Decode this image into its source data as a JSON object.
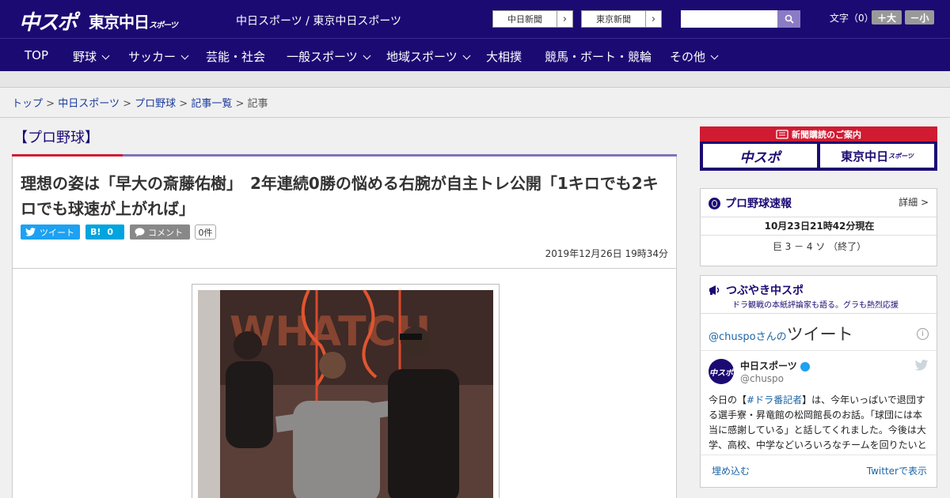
{
  "header": {
    "logo_chuspo": "中スポ",
    "logo_tokyo": "東京中日",
    "logo_tokyo_small": "スポーツ",
    "site_names": "中日スポーツ / 東京中日スポーツ",
    "ext_links": [
      {
        "label": "中日新聞"
      },
      {
        "label": "東京新聞"
      }
    ],
    "search_placeholder": "",
    "font_size_label": "文字（0）",
    "font_plus": "＋大",
    "font_minus": "－小"
  },
  "nav": {
    "items": [
      {
        "label": "TOP"
      },
      {
        "label": "野球"
      },
      {
        "label": "サッカー"
      },
      {
        "label": "芸能・社会"
      },
      {
        "label": "一般スポーツ"
      },
      {
        "label": "地域スポーツ"
      },
      {
        "label": "大相撲"
      },
      {
        "label": "競馬・ボート・競輪"
      },
      {
        "label": "その他"
      }
    ]
  },
  "breadcrumb": {
    "items": [
      "トップ",
      "中日スポーツ",
      "プロ野球",
      "記事一覧"
    ],
    "current": "記事",
    "sep": ">"
  },
  "article": {
    "category": "【プロ野球】",
    "headline": "理想の姿は「早大の斎藤佑樹」　2年連続0勝の悩める右腕が自主トレ公開「1キロでも2キロでも球速が上がれば」",
    "tweet_label": "ツイート",
    "hatena_label": "B!",
    "hatena_count": "0",
    "comment_label": "コメント",
    "comment_count": "0件",
    "date": "2019年12月26日 19時34分",
    "photo_wall_text": "WHATCH"
  },
  "sidebar": {
    "subscribe_title": "新聞購読のご案内",
    "subscribe_logo_1": "中スポ",
    "subscribe_logo_2": "東京中日",
    "subscribe_logo_2_small": "スポーツ",
    "score": {
      "title": "プロ野球速報",
      "detail": "詳細 >",
      "time": "10月23日21時42分現在",
      "line": "巨 3 － 4 ソ （終了）"
    },
    "twitter": {
      "title": "つぶやき中スポ",
      "subtitle": "ドラ観戦の本紙評論家も語る。グラも熱烈応援",
      "account_prefix": "@chuspo",
      "account_suffix": "さんの",
      "tweet_word": "ツイート",
      "avatar_text": "中スポ",
      "name": "中日スポーツ",
      "handle": "@chuspo",
      "text_pre": "今日の【",
      "hashtag": "#ドラ番記者",
      "text_post": "】は、今年いっぱいで退団する選手寮・昇竜館の松岡館長のお話。「球団には本当に感謝している」と話してくれました。今後は大学、高校、中学などいろいろなチームを回りたいと",
      "embed": "埋め込む",
      "view": "Twitterで表示"
    }
  },
  "colors": {
    "brand_navy": "#1c0a73",
    "accent_red": "#d01b32",
    "twitter_blue": "#1da1f2"
  }
}
